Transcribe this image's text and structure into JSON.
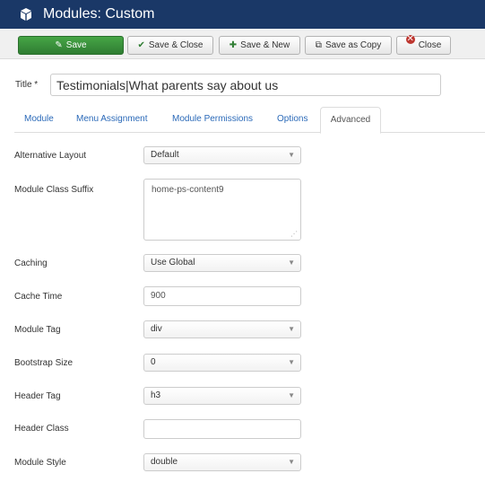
{
  "header": {
    "title": "Modules: Custom",
    "icon": "cube-icon"
  },
  "toolbar": {
    "save": "Save",
    "save_close": "Save & Close",
    "save_new": "Save & New",
    "save_copy": "Save as Copy",
    "close": "Close"
  },
  "title_field": {
    "label": "Title *",
    "value": "Testimonials|What parents say about us"
  },
  "tabs": [
    "Module",
    "Menu Assignment",
    "Module Permissions",
    "Options",
    "Advanced"
  ],
  "active_tab": "Advanced",
  "fields": {
    "alt_layout": {
      "label": "Alternative Layout",
      "value": "Default"
    },
    "class_suffix": {
      "label": "Module Class Suffix",
      "value": "home-ps-content9"
    },
    "caching": {
      "label": "Caching",
      "value": "Use Global"
    },
    "cache_time": {
      "label": "Cache Time",
      "value": "900"
    },
    "module_tag": {
      "label": "Module Tag",
      "value": "div"
    },
    "bootstrap_size": {
      "label": "Bootstrap Size",
      "value": "0"
    },
    "header_tag": {
      "label": "Header Tag",
      "value": "h3"
    },
    "header_class": {
      "label": "Header Class",
      "value": ""
    },
    "module_style": {
      "label": "Module Style",
      "value": "double"
    }
  },
  "colors": {
    "header_bg": "#1a3867",
    "save_green": "#3e9a3e",
    "link_blue": "#2a69b8"
  }
}
